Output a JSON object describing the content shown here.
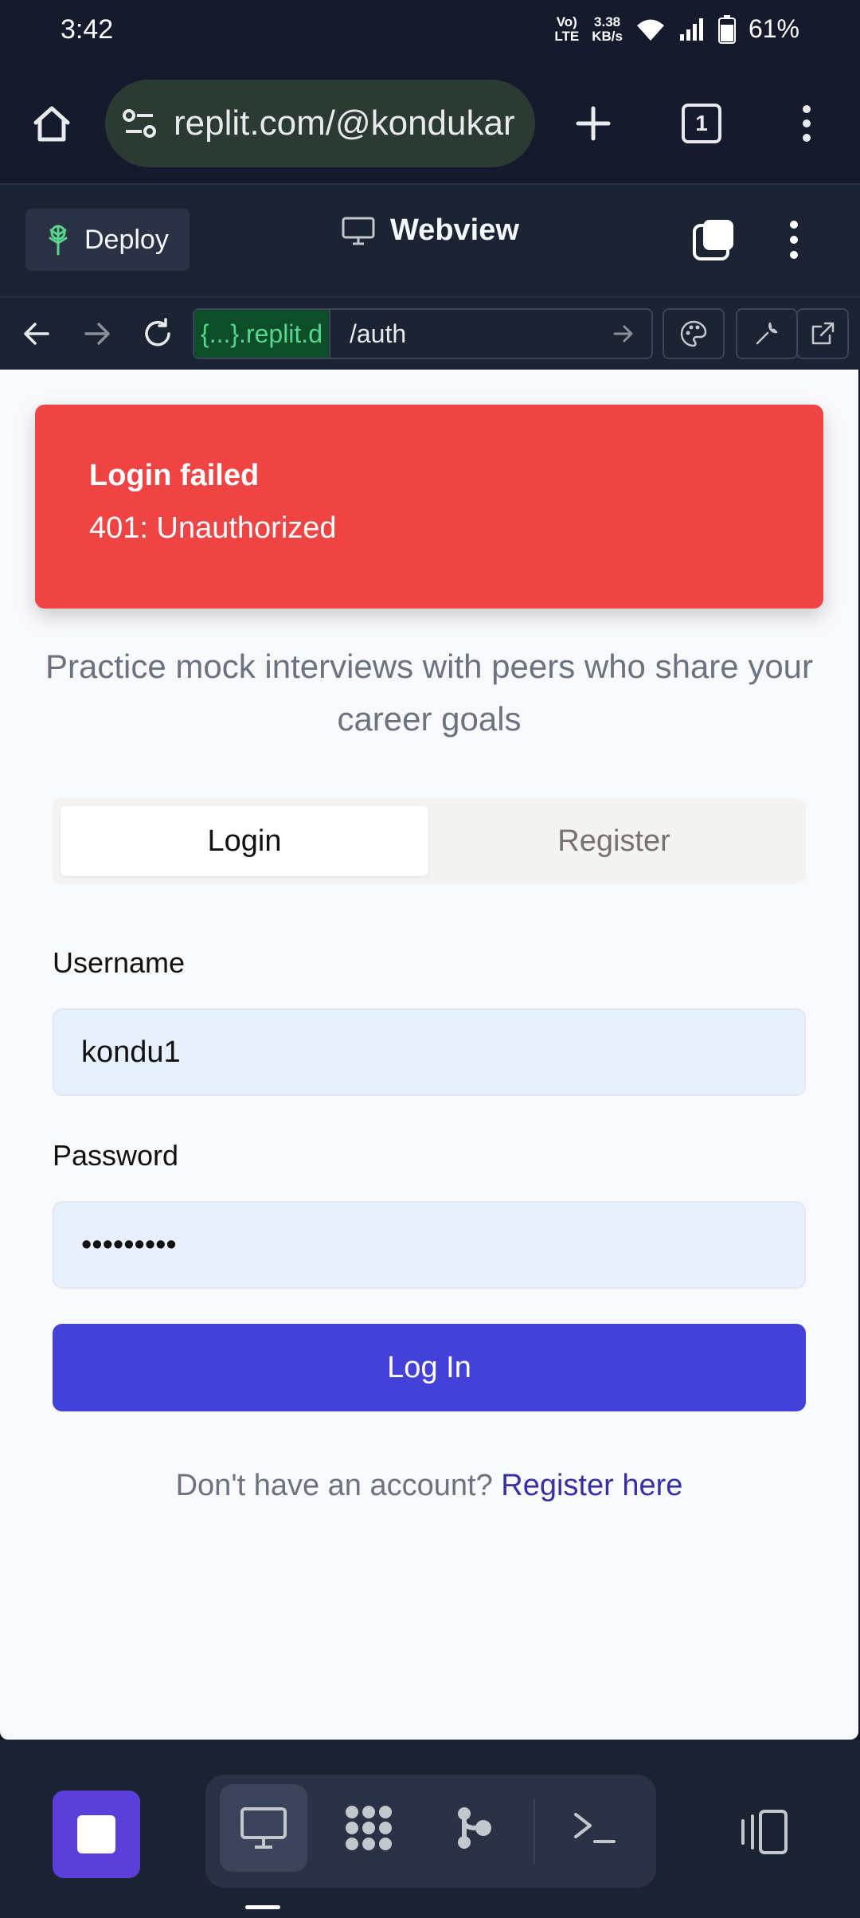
{
  "status_bar": {
    "time": "3:42",
    "volte_line1": "Vo)",
    "volte_line2": "LTE",
    "speed_line1": "3.38",
    "speed_line2": "KB/s",
    "battery": "61%"
  },
  "browser": {
    "url": "replit.com/@kondukar",
    "tab_count": "1"
  },
  "replit_header": {
    "deploy_label": "Deploy",
    "title": "Webview"
  },
  "webview_bar": {
    "domain": "{...}.replit.d",
    "path": "/auth"
  },
  "toast": {
    "title": "Login failed",
    "message": "401: Unauthorized"
  },
  "auth": {
    "tagline": "Practice mock interviews with peers who share your career goals",
    "tab_login": "Login",
    "tab_register": "Register",
    "username_label": "Username",
    "username_value": "kondu1",
    "password_label": "Password",
    "password_value": "•••••••••",
    "login_button": "Log In",
    "footer_prefix": "Don't have an account? ",
    "footer_link": "Register here"
  },
  "colors": {
    "toast_bg": "#ef4444",
    "primary": "#4341d8",
    "deploy_green": "#58d68d",
    "stop_purple": "#5b3fd9"
  }
}
